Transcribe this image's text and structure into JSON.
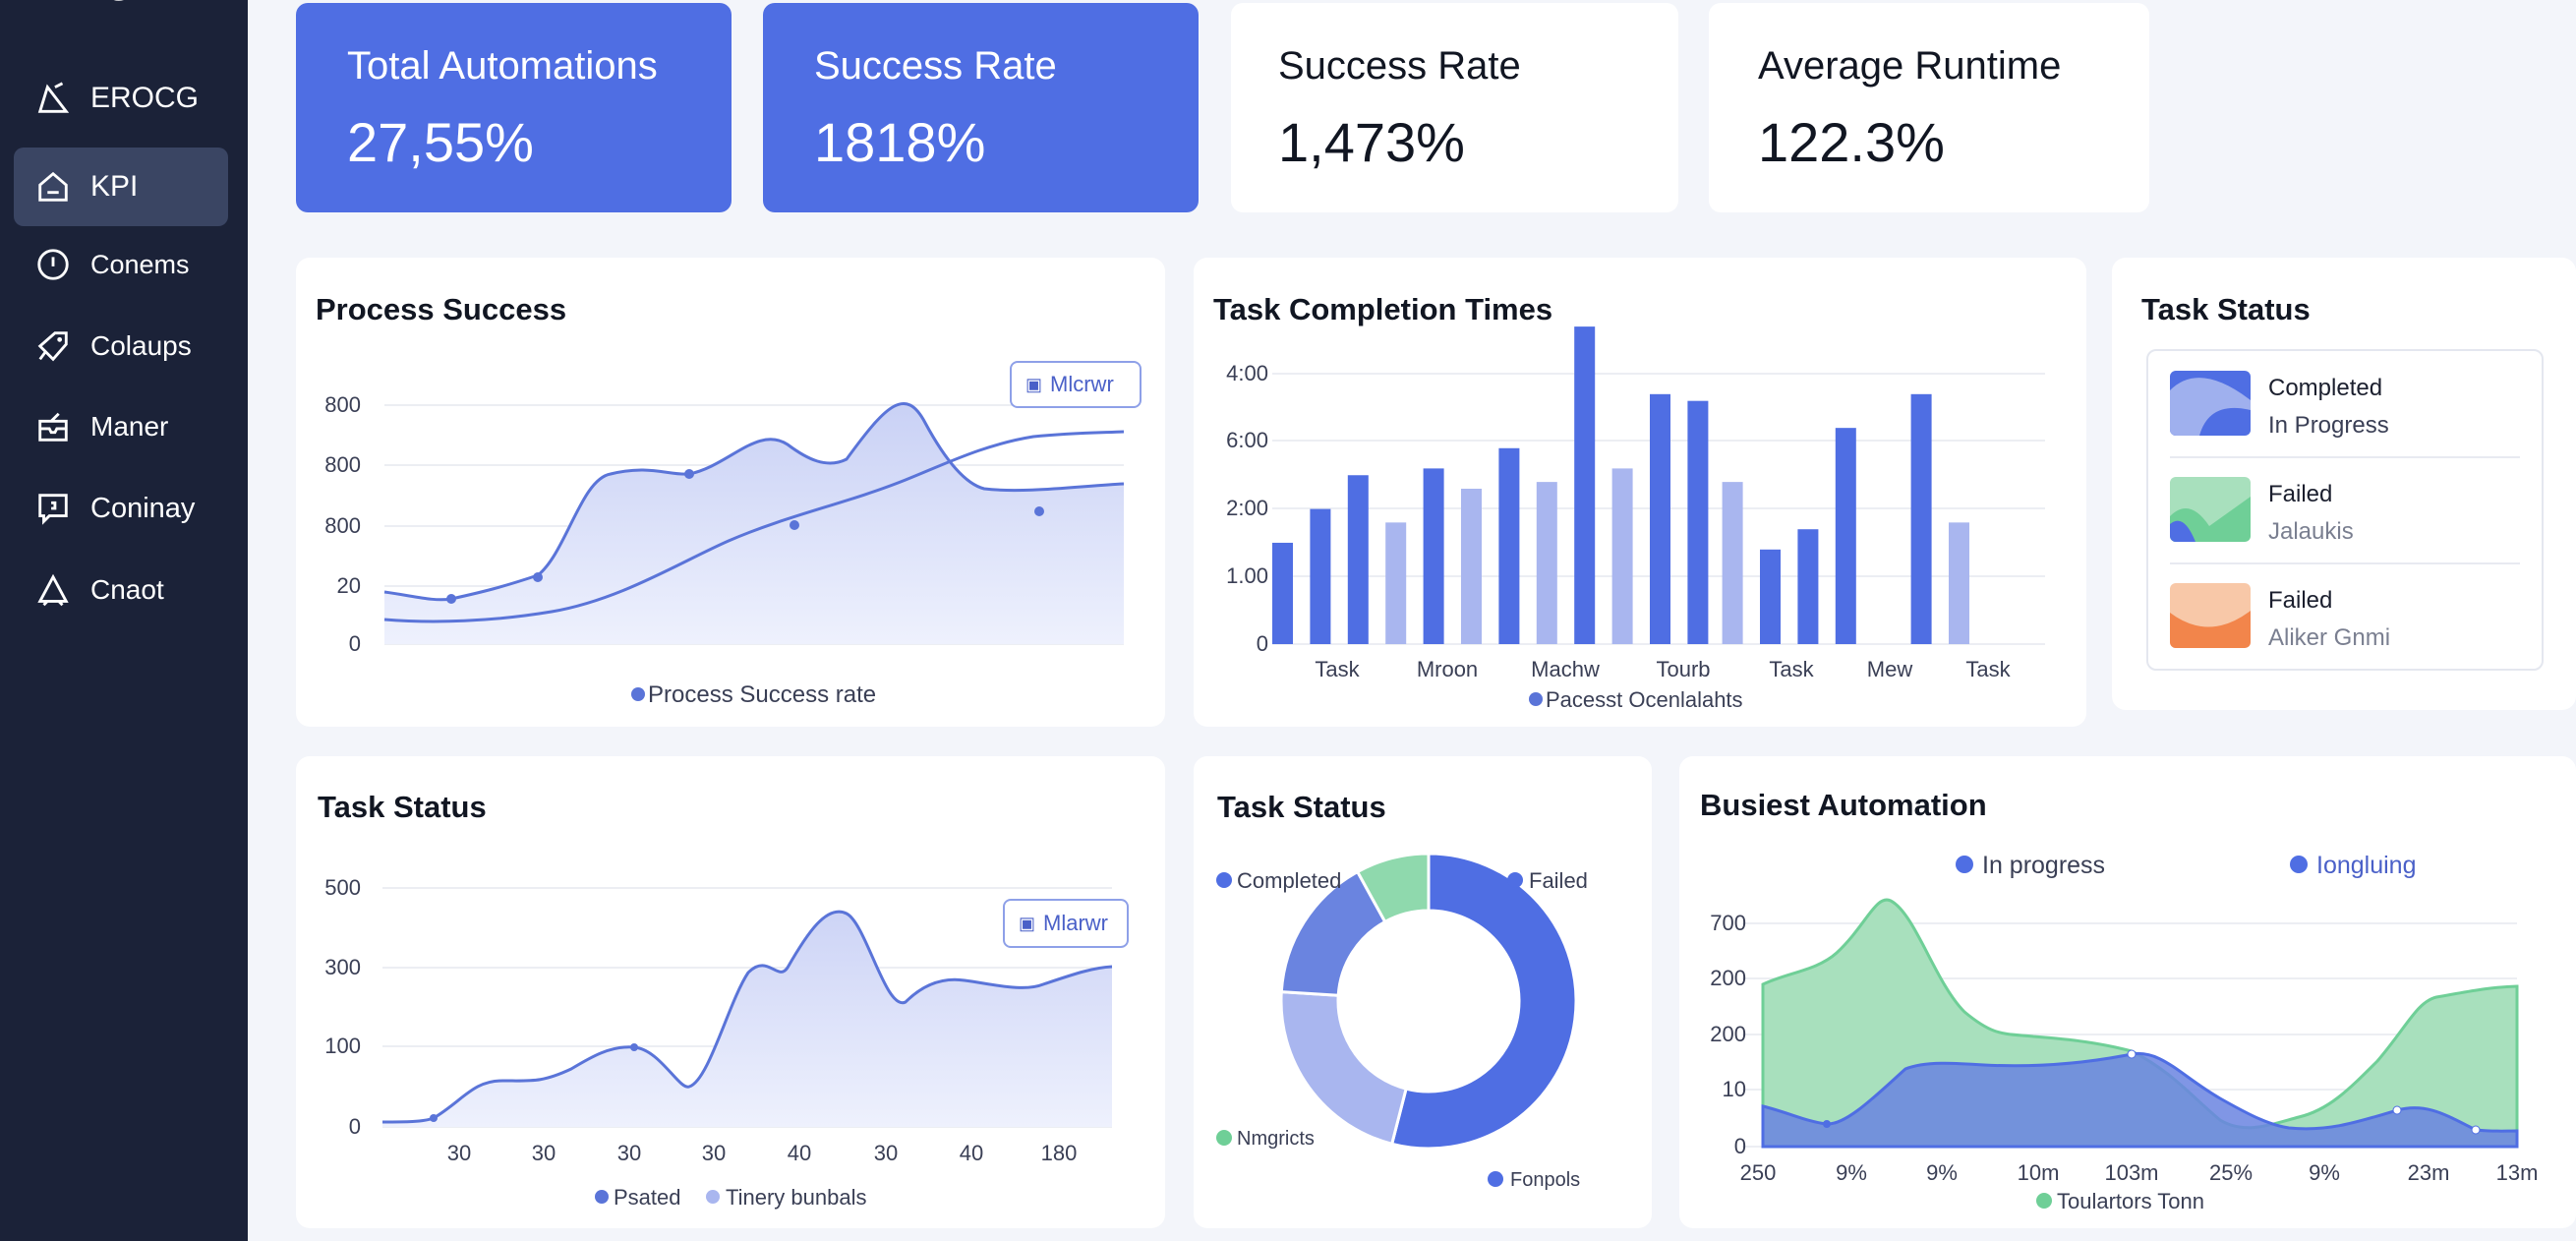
{
  "colors": {
    "accent": "#4f6ee3",
    "sidebar": "#1b2238",
    "green": "#6fcf97",
    "orange": "#f2854b"
  },
  "sidebar": {
    "items": [
      {
        "label": "EROCG",
        "icon": "triangle-warning-icon"
      },
      {
        "label": "KPI",
        "icon": "home-icon"
      },
      {
        "label": "Conems",
        "icon": "info-circle-icon"
      },
      {
        "label": "Colaups",
        "icon": "tag-icon"
      },
      {
        "label": "Maner",
        "icon": "inbox-icon"
      },
      {
        "label": "Coninay",
        "icon": "chat-icon"
      },
      {
        "label": "Cnaot",
        "icon": "triangle-icon"
      }
    ]
  },
  "kpis": [
    {
      "title": "Total Automations",
      "value": "27,55%"
    },
    {
      "title": "Success Rate",
      "value": "1818%"
    },
    {
      "title": "Success Rate",
      "value": "1,473%"
    },
    {
      "title": "Average Runtime",
      "value": "122.3%"
    }
  ],
  "process_success": {
    "title": "Process Success",
    "tooltip": "Mlcrwr",
    "legend": "Process Success rate",
    "y_ticks": [
      "800",
      "800",
      "800",
      "20",
      "0"
    ]
  },
  "task_completion": {
    "title": "Task Completion Times",
    "legend": "Pacesst Ocenlalahts",
    "y_ticks": [
      "4:00",
      "6:00",
      "2:00",
      "1.00",
      "0"
    ],
    "x_ticks": [
      "Task",
      "Mroon",
      "Machw",
      "Tourb",
      "Task",
      "Mew",
      "Task"
    ]
  },
  "task_status_list": {
    "title": "Task Status",
    "items": [
      {
        "line1": "Completed",
        "line2": "In Progress"
      },
      {
        "line1": "Failed",
        "line2": "Jalaukis"
      },
      {
        "line1": "Failed",
        "line2": "Aliker Gnmi"
      }
    ]
  },
  "task_status_line": {
    "title": "Task Status",
    "tooltip": "Mlarwr",
    "y_ticks": [
      "500",
      "300",
      "100",
      "0"
    ],
    "x_ticks": [
      "30",
      "30",
      "30",
      "30",
      "40",
      "30",
      "40",
      "180"
    ],
    "legend": [
      "Psated",
      "Tinery bunbals"
    ]
  },
  "task_status_donut": {
    "title": "Task Status",
    "labels": [
      "Completed",
      "Failed",
      "Nmgricts",
      "Fonpols"
    ]
  },
  "busiest": {
    "title": "Busiest Automation",
    "legend": [
      "In progress",
      "Iongluing"
    ],
    "y_ticks": [
      "700",
      "200",
      "200",
      "10",
      "0"
    ],
    "x_ticks": [
      "250",
      "9%",
      "9%",
      "10m",
      "103m",
      "25%",
      "9%",
      "23m",
      "13m"
    ],
    "bottom_legend": "Toulartors Tonn"
  },
  "chart_data": [
    {
      "type": "line",
      "title": "Process Success",
      "series": [
        {
          "name": "Process Success rate",
          "values": [
            185,
            165,
            240,
            560,
            555,
            600,
            790,
            470,
            500,
            720
          ]
        },
        {
          "values": [
            80,
            70,
            90,
            140,
            230,
            380,
            520,
            640,
            700,
            700
          ]
        }
      ]
    },
    {
      "type": "bar",
      "title": "Task Completion Times",
      "series": [
        {
          "values": [
            1.5,
            2,
            2.5,
            2.6,
            2.9,
            4.7,
            3.7,
            3.6,
            1.4,
            1.7,
            3.2,
            3.7
          ]
        },
        {
          "values": [
            1.8,
            2.3,
            2.4,
            2.6,
            2.4,
            1.8
          ]
        }
      ]
    },
    {
      "type": "line",
      "title": "Task Status",
      "series": [
        {
          "name": "Psated",
          "values": [
            5,
            10,
            60,
            60,
            100,
            100,
            40,
            300,
            270,
            400,
            180,
            240,
            230,
            260,
            300
          ]
        }
      ]
    },
    {
      "type": "pie",
      "title": "Task Status",
      "values": [
        54,
        22,
        16,
        8
      ]
    },
    {
      "type": "area",
      "title": "Busiest Automation",
      "series": [
        {
          "name": "Iongluing",
          "values": [
            300,
            310,
            400,
            600,
            360,
            180,
            170,
            150,
            120,
            80,
            80,
            330,
            300
          ]
        },
        {
          "name": "In progress",
          "values": [
            70,
            60,
            130,
            130,
            130,
            140,
            110,
            70,
            70,
            70,
            60,
            60,
            60
          ]
        }
      ]
    }
  ]
}
